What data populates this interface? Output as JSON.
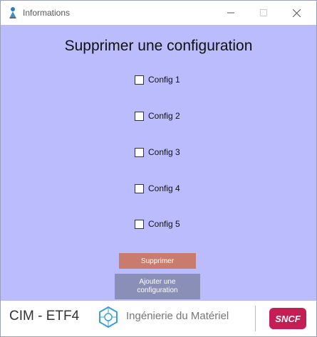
{
  "window": {
    "title": "Informations"
  },
  "heading": "Supprimer une configuration",
  "configs": [
    "Config 1",
    "Config 2",
    "Config 3",
    "Config 4",
    "Config 5"
  ],
  "buttons": {
    "delete": "Supprimer",
    "add_line1": "Ajouter une",
    "add_line2": "configuration"
  },
  "footer": {
    "left": "CIM - ETF4",
    "mid": "Ingénierie du Matériel",
    "brand": "SNCF"
  },
  "colors": {
    "client_bg": "#bbbcfd",
    "delete_btn": "#c97b6e",
    "add_btn": "#8a8fb8",
    "sncf": "#c41e55"
  }
}
